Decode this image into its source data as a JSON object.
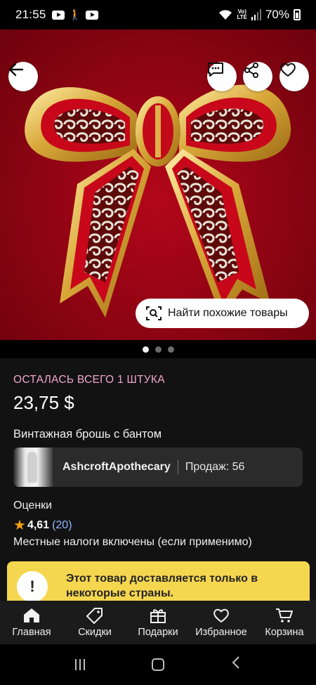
{
  "status_bar": {
    "time": "21:55",
    "network": "Vo) LTE",
    "battery": "70%"
  },
  "hero": {
    "find_similar_label": "Найти похожие товары",
    "image_count": 3,
    "active_image": 1
  },
  "product": {
    "stock_notice": "ОСТАЛАСЬ ВСЕГО 1 ШТУКА",
    "price": "23,75 $",
    "title": "Винтажная брошь с бантом"
  },
  "shop": {
    "name": "AshcroftApothecary",
    "sales": "Продаж: 56"
  },
  "reviews": {
    "label": "Оценки",
    "rating": "4,61",
    "count": "(20)"
  },
  "tax_note": "Местные налоги включены (если применимо)",
  "notice": {
    "icon": "!",
    "text": "Этот товар доставляется только в некоторые страны."
  },
  "bottom_nav": {
    "home": "Главная",
    "deals": "Скидки",
    "gifts": "Подарки",
    "favorites": "Избранное",
    "cart": "Корзина"
  },
  "colors": {
    "accent_pink": "#f2a7c7",
    "star": "#f1a10f",
    "link_blue": "#8fb7ff",
    "notice_yellow": "#f5d64f"
  }
}
